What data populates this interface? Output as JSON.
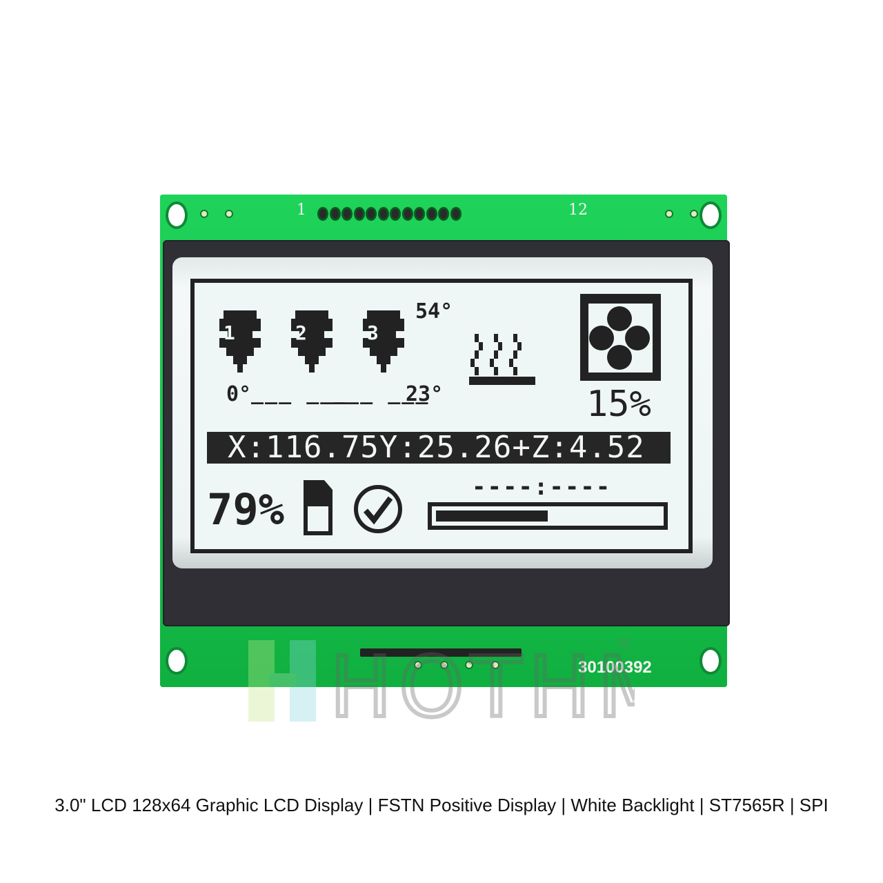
{
  "product": {
    "caption": "3.0\" LCD 128x64 Graphic LCD Display | FSTN Positive Display | White Backlight | ST7565R | SPI",
    "pcb_label_pin_first": "1",
    "pcb_label_pin_last": "12",
    "part_number": "30100392",
    "watermark": "HOTHMI",
    "registered_mark": "®",
    "pin_count": 12,
    "colors": {
      "pcb": "#14c44a",
      "bezel": "#2f2f35",
      "lcd_bg": "#eef6f6",
      "lcd_ink": "#222222"
    }
  },
  "lcd": {
    "extruders": [
      {
        "icon": "nozzle-icon",
        "label": "1",
        "temp_text": "0°"
      },
      {
        "icon": "nozzle-icon",
        "label": "2",
        "temp_text": "---"
      },
      {
        "icon": "nozzle-icon",
        "label": "3",
        "temp_text": "23°"
      }
    ],
    "extruder_dashes_left": "___ ___",
    "extruder_dashes_right": "___ ___",
    "extruder3_target": "54°",
    "bed_icon": "heated-bed-icon",
    "fan_icon": "fan-icon",
    "fan_speed": "15%",
    "coordinates": "X:116.75Y:25.26+Z:4.52",
    "sd_progress_text": "79%",
    "sd_icon": "sd-card-icon",
    "status_icon": "check-circle-icon",
    "elapsed_time": "----:----",
    "progress": 0.5
  }
}
